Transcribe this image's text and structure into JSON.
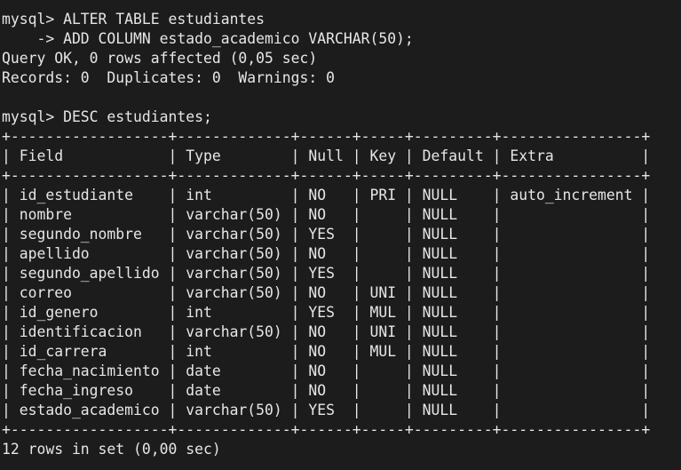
{
  "terminal": {
    "lines": [
      "mysql> ALTER TABLE estudiantes",
      "    -> ADD COLUMN estado_academico VARCHAR(50);",
      "Query OK, 0 rows affected (0,05 sec)",
      "Records: 0  Duplicates: 0  Warnings: 0",
      "",
      "mysql> DESC estudiantes;",
      "+------------------+-------------+------+-----+---------+----------------+",
      "| Field            | Type        | Null | Key | Default | Extra          |",
      "+------------------+-------------+------+-----+---------+----------------+",
      "| id_estudiante    | int         | NO   | PRI | NULL    | auto_increment |",
      "| nombre           | varchar(50) | NO   |     | NULL    |                |",
      "| segundo_nombre   | varchar(50) | YES  |     | NULL    |                |",
      "| apellido         | varchar(50) | NO   |     | NULL    |                |",
      "| segundo_apellido | varchar(50) | YES  |     | NULL    |                |",
      "| correo           | varchar(50) | NO   | UNI | NULL    |                |",
      "| id_genero        | int         | YES  | MUL | NULL    |                |",
      "| identificacion   | varchar(50) | NO   | UNI | NULL    |                |",
      "| id_carrera       | int         | NO   | MUL | NULL    |                |",
      "| fecha_nacimiento | date        | NO   |     | NULL    |                |",
      "| fecha_ingreso    | date        | NO   |     | NULL    |                |",
      "| estado_academico | varchar(50) | YES  |     | NULL    |                |",
      "+------------------+-------------+------+-----+---------+----------------+",
      "12 rows in set (0,00 sec)"
    ]
  }
}
